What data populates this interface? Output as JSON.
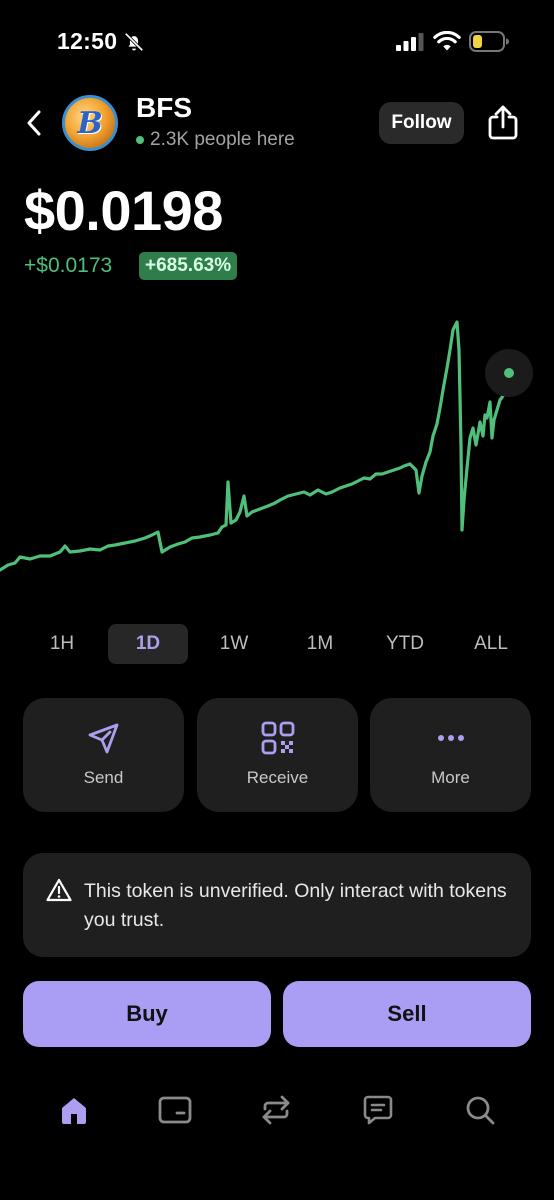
{
  "status_bar": {
    "time": "12:50",
    "icons": [
      "bell-slash-icon",
      "signal-icon",
      "wifi-icon",
      "battery-low-icon"
    ]
  },
  "header": {
    "back_icon": "chevron-left-icon",
    "token_symbol": "BFS",
    "people_count": "2.3K people here",
    "follow_label": "Follow",
    "share_icon": "share-icon"
  },
  "price": {
    "value": "$0.0198",
    "change_abs": "+$0.0173",
    "change_pct": "+685.63%"
  },
  "range_tabs": [
    {
      "label": "1H",
      "active": false
    },
    {
      "label": "1D",
      "active": true
    },
    {
      "label": "1W",
      "active": false
    },
    {
      "label": "1M",
      "active": false
    },
    {
      "label": "YTD",
      "active": false
    },
    {
      "label": "ALL",
      "active": false
    }
  ],
  "actions": [
    {
      "label": "Send",
      "icon": "send-icon"
    },
    {
      "label": "Receive",
      "icon": "qr-code-icon"
    },
    {
      "label": "More",
      "icon": "more-dots-icon"
    }
  ],
  "warning": {
    "icon": "warning-triangle-icon",
    "text": "This token is unverified. Only interact with tokens you trust."
  },
  "trade": {
    "buy_label": "Buy",
    "sell_label": "Sell"
  },
  "bottom_nav": [
    {
      "name": "home",
      "icon": "home-icon",
      "active": true
    },
    {
      "name": "wallet",
      "icon": "wallet-icon",
      "active": false
    },
    {
      "name": "swap",
      "icon": "swap-icon",
      "active": false
    },
    {
      "name": "messages",
      "icon": "chat-icon",
      "active": false
    },
    {
      "name": "search",
      "icon": "search-icon",
      "active": false
    }
  ],
  "colors": {
    "accent": "#a99ef3",
    "positive": "#4fbf7a",
    "background": "#000000",
    "card": "#1f1f1f"
  }
}
